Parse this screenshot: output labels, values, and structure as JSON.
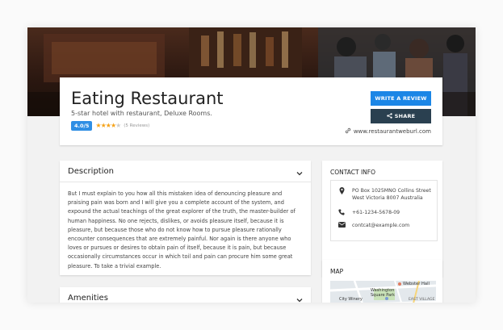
{
  "listing": {
    "title": "Eating Restaurant",
    "subtitle": "5-star hotel with restaurant, Deluxe Rooms.",
    "rating_badge": "4.0/5",
    "rating_value": 4,
    "reviews": "(5 Reviews)",
    "website": "www.restaurantweburl.com"
  },
  "actions": {
    "review_label": "WRITE A REVIEW",
    "share_label": "SHARE"
  },
  "description": {
    "title": "Description",
    "text": "But I must explain to you how all this mistaken idea of denouncing pleasure and praising pain was born and I will give you a complete account of the system, and expound the actual teachings of the great explorer of the truth, the master-builder of human happiness. No one rejects, dislikes, or avoids pleasure itself, because it is pleasure, but because those who do not know how to pursue pleasure rationally encounter consequences that are extremely painful. Nor again is there anyone who loves or pursues or desires to obtain pain of itself, because it is pain, but because occasionally circumstances occur in which toil and pain can procure him some great pleasure. To take a trivial example."
  },
  "amenities": {
    "title": "Amenities"
  },
  "contact": {
    "title": "CONTACT INFO",
    "address_line1": "PO Box 1025MNO Collins Street",
    "address_line2": "West Victoria 8007 Australia",
    "phone": "+61-1234-5678-09",
    "email": "contcat@example.com"
  },
  "map": {
    "title": "MAP",
    "labels": {
      "webster": "Webster Hall",
      "washington": "Washington",
      "square_park": "Square Park",
      "city_winery": "City Winery",
      "east_village": "EAST VILLAGE"
    }
  },
  "colors": {
    "primary": "#1b86e6",
    "dark": "#2a4050",
    "star": "#f5a31a",
    "badge": "#2f8ee4"
  }
}
